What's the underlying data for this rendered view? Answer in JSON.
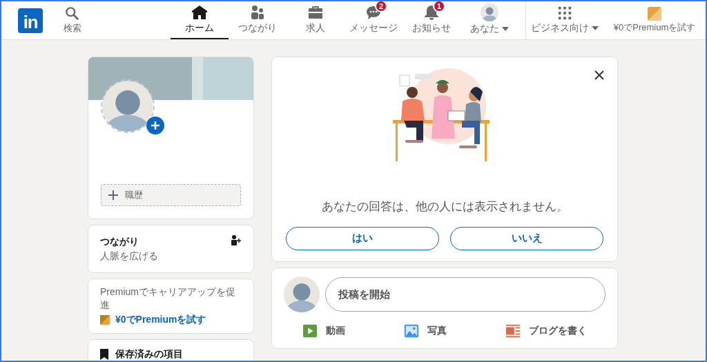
{
  "header": {
    "logo": "in",
    "search": {
      "label": "検索"
    },
    "nav": [
      {
        "kind": "home",
        "label": "ホーム",
        "selected": true
      },
      {
        "kind": "network",
        "label": "つながり",
        "selected": false
      },
      {
        "kind": "jobs",
        "label": "求人",
        "selected": false
      },
      {
        "kind": "messages",
        "label": "メッセージ",
        "selected": false,
        "badge": "2"
      },
      {
        "kind": "notifications",
        "label": "お知らせ",
        "selected": false,
        "badge": "1"
      },
      {
        "kind": "me",
        "label": "あなた",
        "selected": false,
        "dropdown": true
      }
    ],
    "business": {
      "label": "ビジネス向け",
      "dropdown": true
    },
    "premium": {
      "label": "¥0でPremiumを試す"
    }
  },
  "profile_card": {
    "experience_button": "職歴"
  },
  "connections_card": {
    "title": "つながり",
    "subtitle": "人脈を広げる"
  },
  "premium_card": {
    "text": "Premiumでキャリアアップを促進",
    "link": "¥0でPremiumを試す"
  },
  "saved_card": {
    "title": "保存済みの項目"
  },
  "survey_card": {
    "question": "あなたの回答は、他の人には表示されません。",
    "buttons": [
      "はい",
      "いいえ"
    ]
  },
  "share_box": {
    "placeholder": "投稿を開始",
    "actions": [
      {
        "kind": "video",
        "label": "動画"
      },
      {
        "kind": "photo",
        "label": "写真"
      },
      {
        "kind": "article",
        "label": "ブログを書く"
      }
    ]
  }
}
